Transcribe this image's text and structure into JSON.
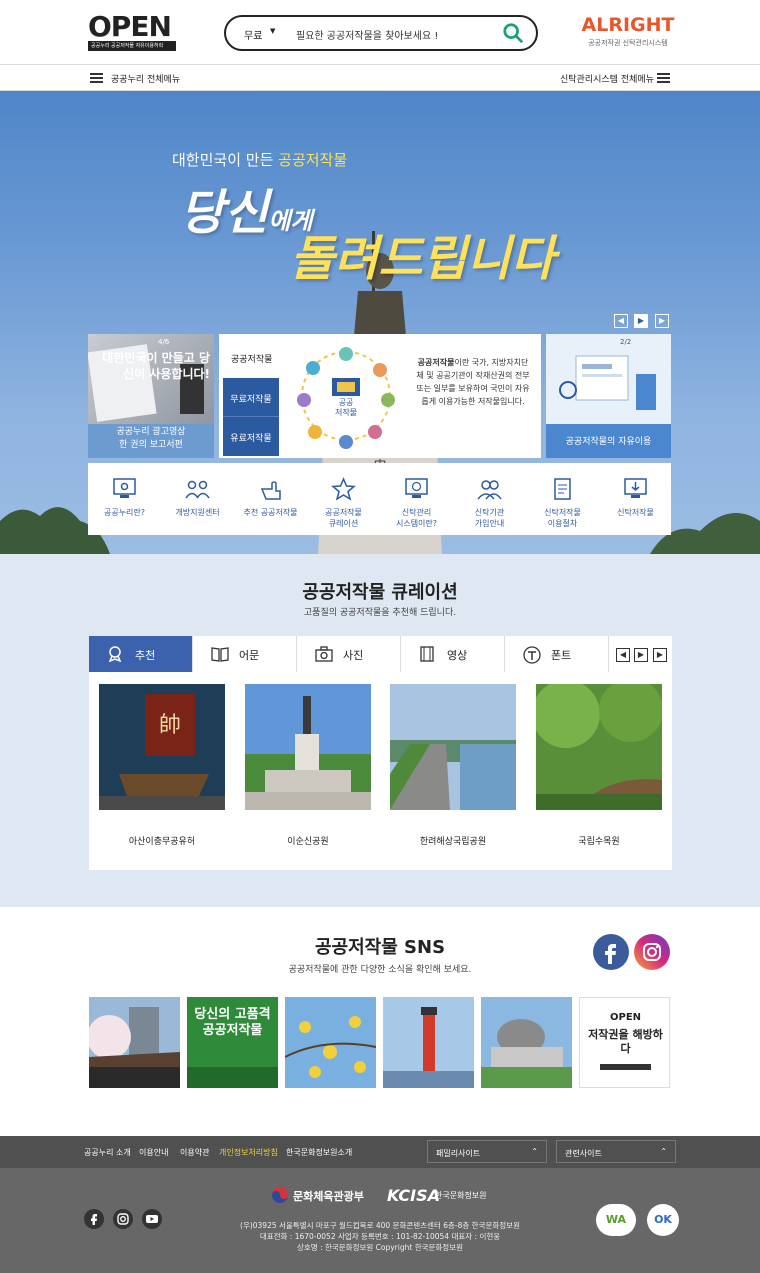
{
  "header": {
    "logo_text": "OPEN",
    "logo_sub": "공공누리  공공저작물 자유이용허락",
    "search_select": "무료",
    "search_placeholder": "필요한 공공저작물을 찾아보세요 !",
    "alright_title": "ALRIGHT",
    "alright_sub": "공공저작권 신탁관리시스템"
  },
  "nav": {
    "left_label": "공공누리 전체메뉴",
    "right_label": "신탁관리시스템 전체메뉴"
  },
  "hero": {
    "subtitle_prefix": "대한민국이 만든 ",
    "subtitle_highlight": "공공저작물",
    "line1_big": "당신",
    "line1_small": "에게",
    "line2": "돌려드립니다"
  },
  "cards": {
    "left": {
      "page": "4/6",
      "image_text": "대한민국이 만들고 당신이 사용합니다!",
      "caption_line1": "공공누리 광고영상",
      "caption_line2": "한 권의 보고서편"
    },
    "middle": {
      "title": "공공저작물",
      "btn_free": "무료저작물",
      "btn_paid": "유료저작물",
      "center_label": "공공\n저작물",
      "desc_bold": "공공저작물",
      "desc_rest": "이란 국가, 지방자치단체 및 공공기관이 작재산권의 전부 또는 일부를 보유하여 국민이 자유롭게 이용가능한 저작물입니다."
    },
    "right": {
      "page": "2/2",
      "caption": "공공저작물의 자유이용"
    }
  },
  "quick_menu": [
    {
      "label": "공공누리란?",
      "icon": "monitor-icon"
    },
    {
      "label": "개방지원센터",
      "icon": "people-icon"
    },
    {
      "label": "추천 공공저작물",
      "icon": "hand-pointer-icon"
    },
    {
      "label": "공공저작물\n큐레이션",
      "icon": "star-icon"
    },
    {
      "label": "신탁관리\n시스템이란?",
      "icon": "copyright-monitor-icon"
    },
    {
      "label": "신탁기관\n가입안내",
      "icon": "group-icon"
    },
    {
      "label": "신탁저작물\n이용절차",
      "icon": "document-icon"
    },
    {
      "label": "신탁저작물",
      "icon": "download-monitor-icon"
    }
  ],
  "curation": {
    "title": "공공저작물 큐레이션",
    "subtitle": "고품질의 공공저작물을 추천해 드립니다.",
    "tabs": [
      {
        "label": "추천",
        "icon": "medal-icon"
      },
      {
        "label": "어문",
        "icon": "book-icon"
      },
      {
        "label": "사진",
        "icon": "camera-icon"
      },
      {
        "label": "영상",
        "icon": "film-icon"
      },
      {
        "label": "폰트",
        "icon": "font-icon"
      }
    ],
    "items": [
      {
        "label": "아산이충무공유허"
      },
      {
        "label": "이순신공원"
      },
      {
        "label": "한려해상국립공원"
      },
      {
        "label": "국립수목원"
      }
    ]
  },
  "sns": {
    "title": "공공저작물 SNS",
    "subtitle": "공공저작물에 관한 다양한 소식을 확인해 보세요.",
    "thumb2_text": "당신의 고품격 공공저작물",
    "thumb6_logo": "OPEN",
    "thumb6_text": "저작권을 해방하다"
  },
  "footer": {
    "links": [
      "공공누리 소개",
      "이용안내",
      "이용약관",
      "개인정보처리방침",
      "한국문화정보원소개"
    ],
    "family_site": "패밀리사이트",
    "related_site": "관련사이트",
    "ministry": "문화체육관광부",
    "kcisa": "KCISA",
    "kcisa_sub": "한국문화정보원",
    "address": "(우)03925  서울특별시 마포구 월드컵북로 400 문화콘텐츠센터 6층-8층 한국문화정보원",
    "phone": "대표전화 : 1670-0052   사업자 등록번호 : 101-82-10054   대표자 : 이현웅",
    "copyright": "상호명 : 한국문화정보원   Copyright 한국문화정보원",
    "wa_label": "WA",
    "ok_label": "OK"
  },
  "colors": {
    "primary": "#3d62ad",
    "accent_yellow": "#ffe15a",
    "alright_orange": "#e8562a",
    "footer_dark": "#505050"
  }
}
